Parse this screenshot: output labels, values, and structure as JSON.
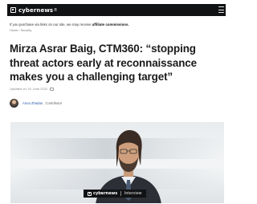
{
  "header": {
    "brand": "cybernews",
    "brand_mark": "®",
    "menu_icon": "hamburger-menu-icon"
  },
  "disclosure": {
    "text": "If you purchase via links on our site, we may receive ",
    "bold": "affiliate commissions."
  },
  "breadcrumb": "Home  ›  Security",
  "article": {
    "title": "Mirza Asrar Baig, CTM360: “stopping threat actors early at reconnaissance makes you a challenging target”",
    "updated": "Updated on: 01 June 2022",
    "author_name": "Anna Zhadan",
    "author_role": ", Contributor"
  },
  "hero": {
    "badge_brand": "cybernews",
    "badge_label": "Interview"
  },
  "colors": {
    "header_bg": "#111214",
    "author_link": "#2a59a8"
  }
}
